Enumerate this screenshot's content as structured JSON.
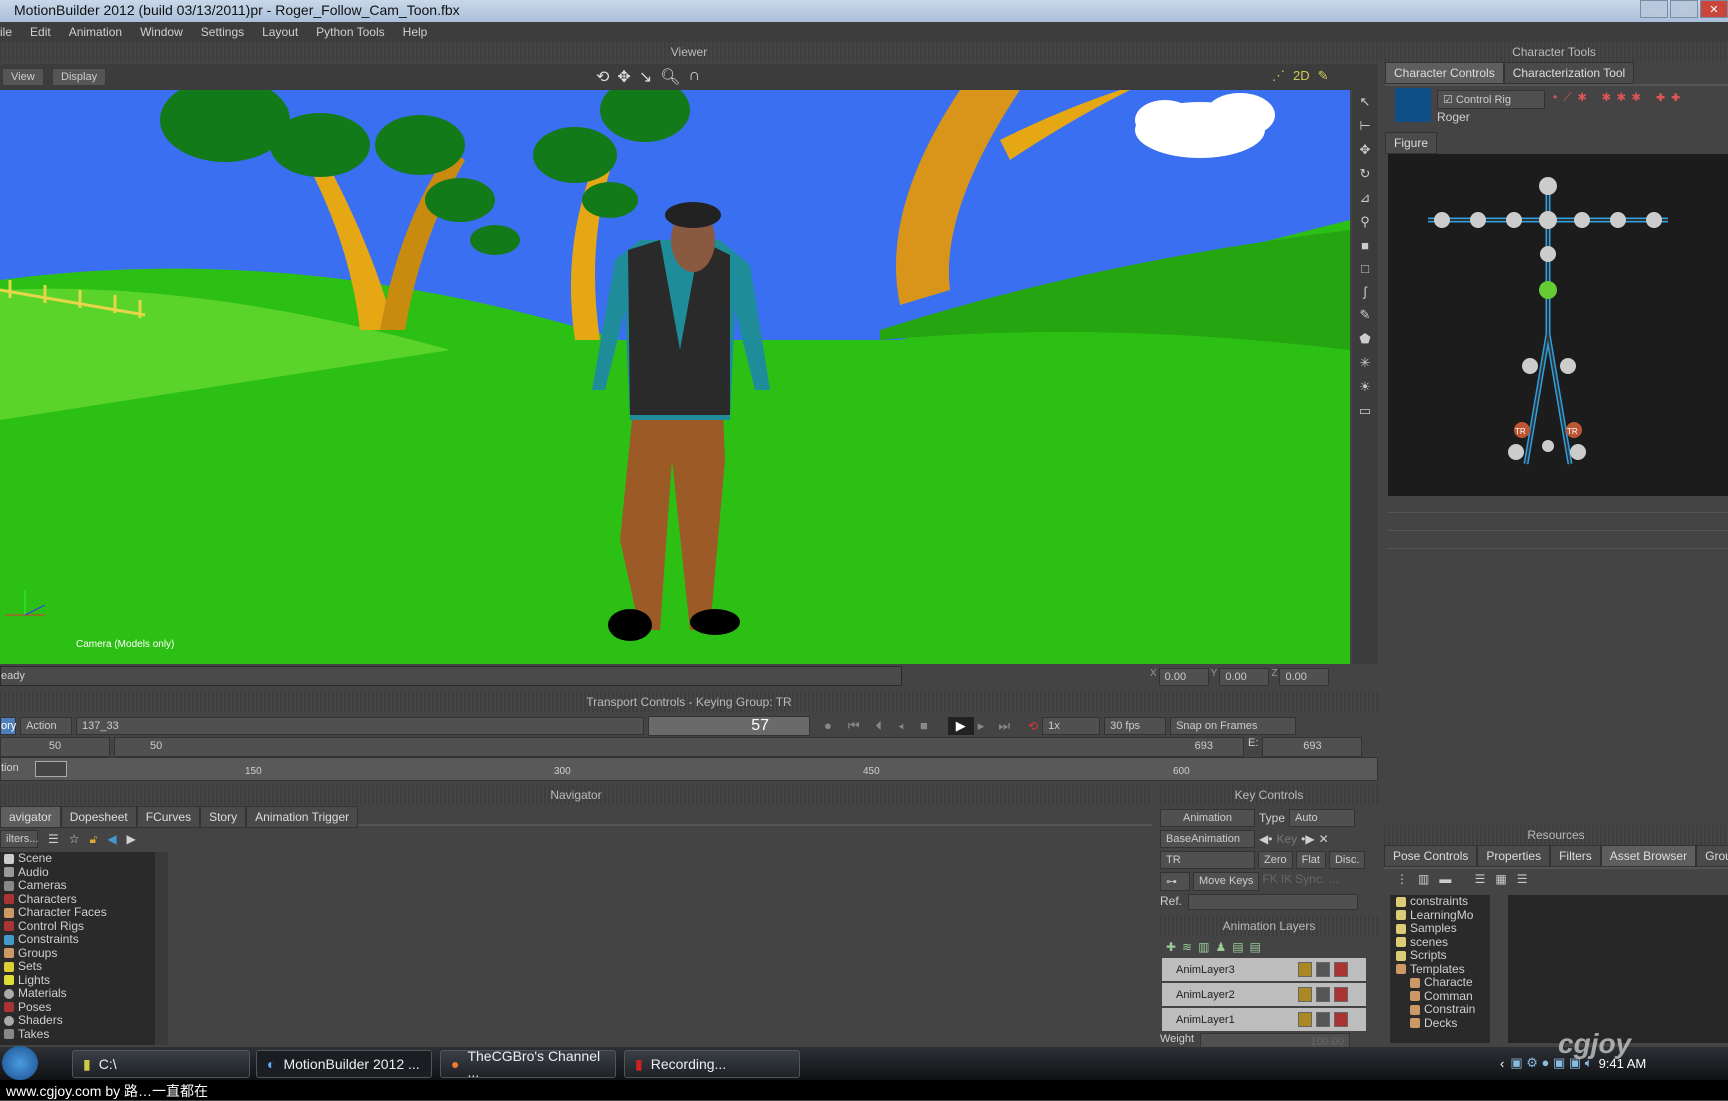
{
  "window": {
    "title": "MotionBuilder 2012   (build 03/13/2011)pr  - Roger_Follow_Cam_Toon.fbx"
  },
  "menu": [
    "ile",
    "Edit",
    "Animation",
    "Window",
    "Settings",
    "Layout",
    "Python Tools",
    "Help"
  ],
  "viewer": {
    "header": "Viewer",
    "view_btn": "View",
    "display_btn": "Display",
    "camera_label": "Camera (Models only)",
    "status": "eady",
    "coords": {
      "x_label": "X",
      "x": "0.00",
      "y_label": "Y",
      "y": "0.00",
      "z_label": "Z",
      "z": "0.00"
    }
  },
  "colors": {
    "sky": "#3a6ff2",
    "grass": "#2cc014",
    "panel": "#444444",
    "accent_blue": "#2aa0e0"
  },
  "transport": {
    "header": "Transport Controls  -  Keying Group: TR",
    "mode": "ory",
    "action": "Action",
    "take": "137_33",
    "frame": "57",
    "speed": "1x",
    "fps": "30 fps",
    "snap": "Snap on Frames",
    "start": "50",
    "range_start": "50",
    "range_end": "693",
    "end_label": "E:",
    "end": "693",
    "ticks": [
      "150",
      "300",
      "450",
      "600"
    ],
    "timeline_label": "tion"
  },
  "navigator": {
    "header": "Navigator",
    "tabs": [
      "avigator",
      "Dopesheet",
      "FCurves",
      "Story",
      "Animation Trigger"
    ],
    "filters": "ilters...",
    "items": [
      "Scene",
      "Audio",
      "Cameras",
      "Characters",
      "Character Faces",
      "Control Rigs",
      "Constraints",
      "Groups",
      "Sets",
      "Lights",
      "Materials",
      "Poses",
      "Shaders",
      "Takes"
    ]
  },
  "key_controls": {
    "header": "Key Controls",
    "animation": "Animation",
    "type_label": "Type",
    "type": "Auto",
    "layer": "BaseAnimation",
    "key": "Key",
    "group": "TR",
    "zero": "Zero",
    "flat": "Flat",
    "disc": "Disc.",
    "move_keys": "Move Keys",
    "fk": "FK",
    "ik": "IK",
    "sync": "Sync. ...",
    "ref": "Ref.",
    "layers_header": "Animation Layers",
    "layers": [
      "AnimLayer3",
      "AnimLayer2",
      "AnimLayer1"
    ],
    "weight_label": "Weight",
    "weight": "100.00"
  },
  "character_tools": {
    "header": "Character Tools",
    "tabs": [
      "Character Controls",
      "Characterization Tool"
    ],
    "control_rig": "Control Rig",
    "character": "Roger",
    "figure_tab": "Figure",
    "tr_label": "TR"
  },
  "resources": {
    "header": "Resources",
    "tabs": [
      "Pose Controls",
      "Properties",
      "Filters",
      "Asset Browser",
      "Group"
    ],
    "tree": [
      "constraints",
      "LearningMo",
      "Samples",
      "scenes",
      "Scripts",
      "Templates",
      "Characte",
      "Comman",
      "Constrain",
      "Decks"
    ]
  },
  "taskbar": {
    "items": [
      "C:\\",
      "MotionBuilder 2012 ...",
      "TheCGBro's Channel ...",
      "Recording..."
    ],
    "time": "9:41 AM"
  },
  "watermark": {
    "caption": "www.cgjoy.com by 路…一直都在",
    "logo": "cgjoy"
  }
}
